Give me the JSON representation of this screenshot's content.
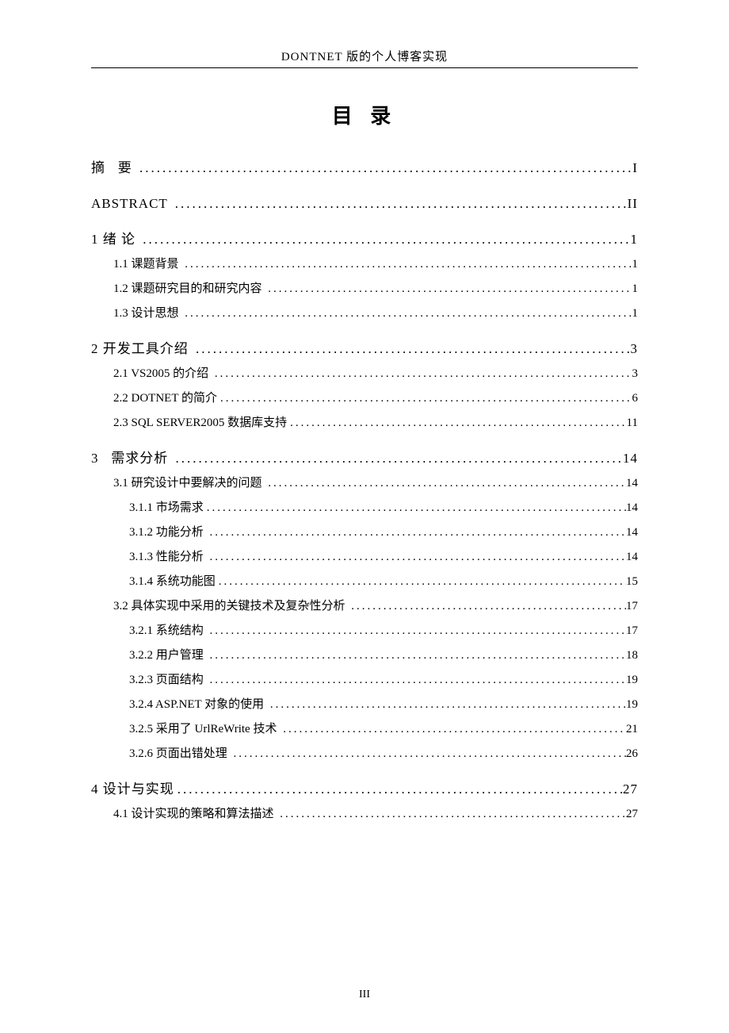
{
  "header_title": "DONTNET 版的个人博客实现",
  "main_title": "目 录",
  "page_number": "III",
  "toc": [
    {
      "level": 0,
      "label": "摘   要 ",
      "page": "I"
    },
    {
      "level": 0,
      "label": "ABSTRACT ",
      "page": "II"
    },
    {
      "level": 0,
      "label": "1 绪 论 ",
      "page": "1"
    },
    {
      "level": 1,
      "label": "1.1 课题背景 ",
      "page": "1"
    },
    {
      "level": 1,
      "label": "1.2 课题研究目的和研究内容 ",
      "page": "1"
    },
    {
      "level": 1,
      "label": "1.3 设计思想 ",
      "page": "1"
    },
    {
      "level": 0,
      "label": "2 开发工具介绍 ",
      "page": "3"
    },
    {
      "level": 1,
      "label": "2.1 VS2005 的介绍 ",
      "page": "3"
    },
    {
      "level": 1,
      "label": "2.2 DOTNET 的简介",
      "page": "6"
    },
    {
      "level": 1,
      "label": "2.3 SQL SERVER2005 数据库支持",
      "page": "11"
    },
    {
      "level": 0,
      "label": "3   需求分析 ",
      "page": "14"
    },
    {
      "level": 1,
      "label": "3.1 研究设计中要解决的问题 ",
      "page": "14"
    },
    {
      "level": 2,
      "label": "3.1.1 市场需求",
      "page": "14"
    },
    {
      "level": 2,
      "label": "3.1.2 功能分析 ",
      "page": "14"
    },
    {
      "level": 2,
      "label": "3.1.3 性能分析 ",
      "page": "14"
    },
    {
      "level": 2,
      "label": "3.1.4 系统功能图",
      "page": "15"
    },
    {
      "level": 1,
      "label": "3.2 具体实现中采用的关键技术及复杂性分析 ",
      "page": "17"
    },
    {
      "level": 2,
      "label": "3.2.1 系统结构 ",
      "page": "17"
    },
    {
      "level": 2,
      "label": "3.2.2 用户管理 ",
      "page": "18"
    },
    {
      "level": 2,
      "label": "3.2.3 页面结构 ",
      "page": "19"
    },
    {
      "level": 2,
      "label": "3.2.4 ASP.NET 对象的使用 ",
      "page": "19"
    },
    {
      "level": 2,
      "label": "3.2.5 采用了 UrlReWrite 技术 ",
      "page": "21"
    },
    {
      "level": 2,
      "label": "3.2.6 页面出错处理 ",
      "page": "26"
    },
    {
      "level": 0,
      "label": "4 设计与实现",
      "page": "27"
    },
    {
      "level": 1,
      "label": "4.1 设计实现的策略和算法描述 ",
      "page": "27"
    }
  ]
}
